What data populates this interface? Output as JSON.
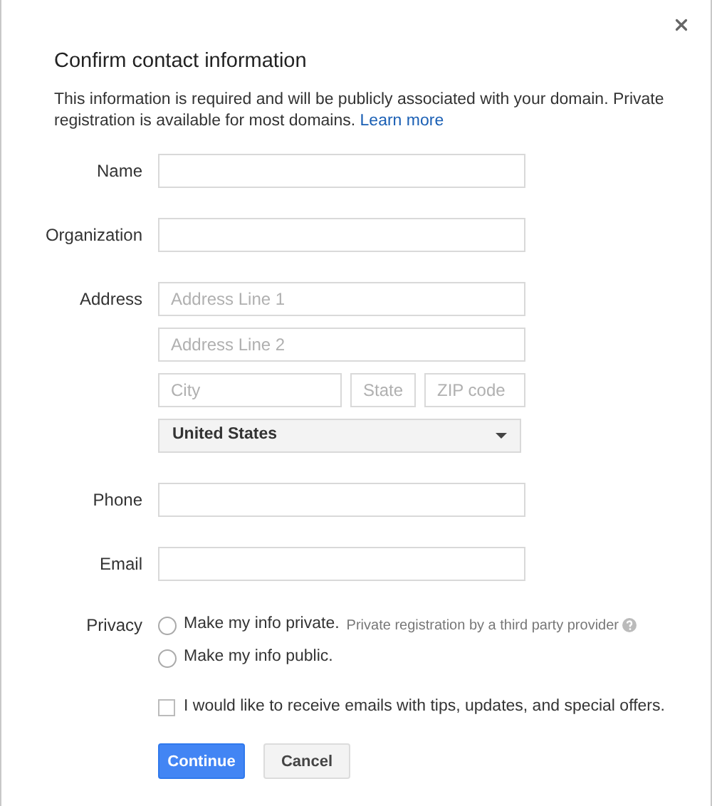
{
  "dialog": {
    "title": "Confirm contact information",
    "description": "This information is required and will be publicly associated with your domain. Private registration is available for most domains.",
    "learn_more_link": "Learn more",
    "fields": [
      {
        "kind": "text",
        "label": "Name"
      },
      {
        "kind": "text",
        "label": "Organization"
      },
      {
        "kind": "address",
        "label": "Address",
        "address_line_1": {
          "placeholder": "Address Line 1"
        },
        "address_line_2": {
          "placeholder": "Address Line 2"
        },
        "city": {
          "placeholder": "City"
        },
        "state": {
          "placeholder": "State"
        },
        "zip": {
          "placeholder": "ZIP code"
        },
        "country": {
          "value": "United States"
        }
      },
      {
        "kind": "text",
        "label": "Phone"
      },
      {
        "kind": "text",
        "label": "Email"
      }
    ],
    "privacy": {
      "label": "Privacy",
      "options": [
        {
          "label": "Make my info private.",
          "note": "Private registration by a third party provider",
          "selected": false
        },
        {
          "label": "Make my info public.",
          "selected": false
        }
      ]
    },
    "newsletter": {
      "label": "I would like to receive emails with tips, updates, and special offers.",
      "checked": false
    },
    "buttons": [
      {
        "label": "Continue",
        "kind": "primary"
      },
      {
        "label": "Cancel",
        "kind": "secondary"
      }
    ]
  }
}
